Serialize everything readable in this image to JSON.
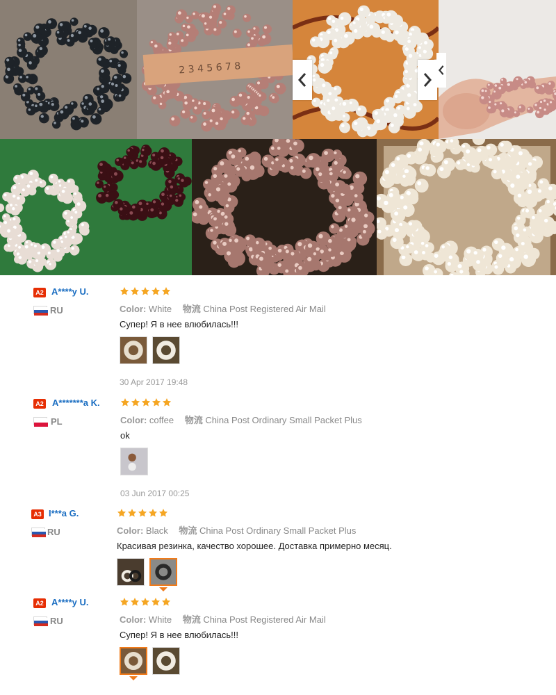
{
  "gallery": {
    "photos": [
      {
        "name": "photo-black-pearl-scrunchie"
      },
      {
        "name": "photo-pink-scrunchie-with-tape-measure"
      },
      {
        "name": "photo-white-pearl-scrunchie"
      },
      {
        "name": "photo-hand-holding-scrunchie"
      },
      {
        "name": "photo-white-and-black-scrunchies"
      },
      {
        "name": "photo-coffee-pearl-scrunchie"
      },
      {
        "name": "photo-scrunchie-in-bag"
      }
    ],
    "prev_icon": "chevron-left-icon",
    "next_icon": "chevron-right-icon"
  },
  "colors": {
    "accent": "#e62e04",
    "buyer_name": "#1b6ec2",
    "star": "#f5a623",
    "active_border": "#f07b1a"
  },
  "reviews": [
    {
      "level": "A2",
      "buyer": "A****y U.",
      "country": "RU",
      "flag": "russia-flag",
      "stars": 5,
      "color_label": "Color:",
      "color": "White",
      "shipping_label": "物流",
      "shipping": "China Post Registered Air Mail",
      "text": "Супер! Я в нее влюбилась!!!",
      "thumbs": 2,
      "date": "30 Apr 2017 19:48"
    },
    {
      "level": "A2",
      "buyer": "A*******a K.",
      "country": "PL",
      "flag": "poland-flag",
      "stars": 5,
      "color_label": "Color:",
      "color": "coffee",
      "shipping_label": "物流",
      "shipping": "China Post Ordinary Small Packet Plus",
      "text": "ok",
      "thumbs": 1,
      "date": "03 Jun 2017 00:25"
    },
    {
      "level": "A3",
      "buyer": "I***a G.",
      "country": "RU",
      "flag": "russia-flag",
      "stars": 5,
      "color_label": "Color:",
      "color": "Black",
      "shipping_label": "物流",
      "shipping": "China Post Ordinary Small Packet Plus",
      "text": "Красивая резинка, качество хорошее. Доставка примерно месяц.",
      "thumbs": 2,
      "date": ""
    },
    {
      "level": "A2",
      "buyer": "A****y U.",
      "country": "RU",
      "flag": "russia-flag",
      "stars": 5,
      "color_label": "Color:",
      "color": "White",
      "shipping_label": "物流",
      "shipping": "China Post Registered Air Mail",
      "text": "Супер! Я в нее влюбилась!!!",
      "thumbs": 2,
      "date": ""
    }
  ]
}
